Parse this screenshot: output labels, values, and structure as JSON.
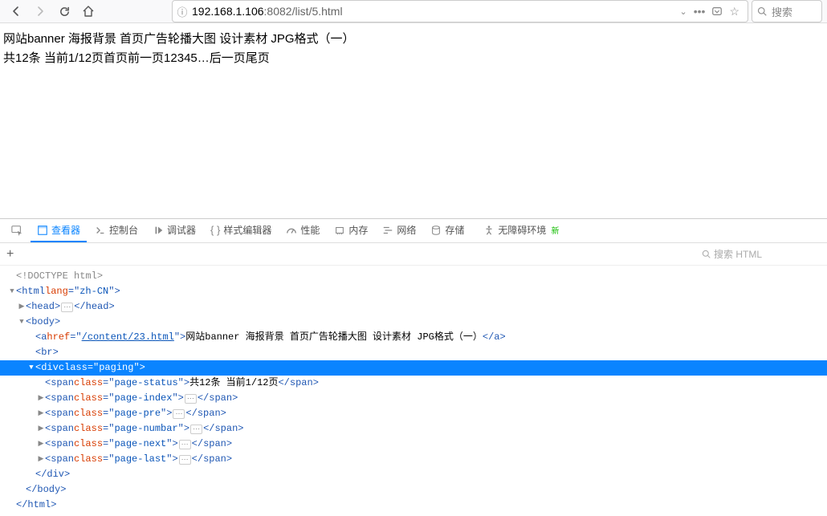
{
  "nav": {
    "url_pre": "192.168.1.106",
    "url_post": ":8082/list/5.html"
  },
  "search_placeholder": "搜索",
  "page": {
    "line1": "网站banner 海报背景 首页广告轮播大图 设计素材 JPG格式（一）",
    "line2": "共12条 当前1/12页首页前一页12345…后一页尾页"
  },
  "devtools": {
    "tabs": {
      "inspector": "查看器",
      "console": "控制台",
      "debugger": "调试器",
      "style": "样式编辑器",
      "perf": "性能",
      "memory": "内存",
      "network": "网络",
      "storage": "存储",
      "a11y": "无障碍环境",
      "new": "新"
    },
    "search_placeholder": "搜索 HTML",
    "dom": {
      "doctype": "<!DOCTYPE html>",
      "html_open": "html",
      "html_lang_attr": "lang",
      "html_lang_val": "zh-CN",
      "head": "head",
      "body": "body",
      "a_tag": "a",
      "a_href_attr": "href",
      "a_href_val": "/content/23.html",
      "a_text": "网站banner 海报背景 首页广告轮播大图 设计素材 JPG格式（一）",
      "br": "br",
      "div_tag": "div",
      "div_class_attr": "class",
      "div_class_val": "paging",
      "span_tag": "span",
      "span_class_attr": "class",
      "span_status_val": "page-status",
      "span_status_text": "共12条 当前1/12页",
      "span_index_val": "page-index",
      "span_pre_val": "page-pre",
      "span_number_val": "page-numbar",
      "span_next_val": "page-next",
      "span_last_val": "page-last"
    }
  }
}
